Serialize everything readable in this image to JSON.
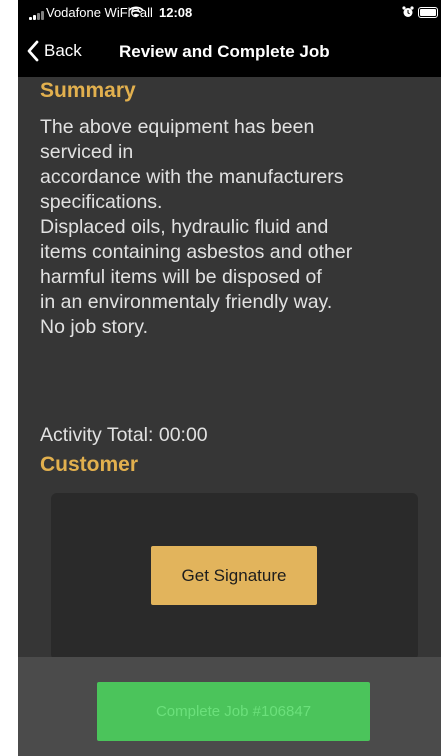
{
  "status_bar": {
    "carrier": "Vodafone WiFiCall",
    "time": "12:08",
    "icons": [
      "signal-icon",
      "wifi-icon",
      "alarm-icon",
      "battery-icon"
    ]
  },
  "nav": {
    "back_label": "Back",
    "title": "Review and Complete Job"
  },
  "summary": {
    "heading": "Summary",
    "lines": [
      "The above equipment has been",
      "serviced in",
      "accordance with the manufacturers",
      "specifications.",
      "Displaced oils, hydraulic fluid and",
      "items containing asbestos and other",
      "harmful items will be disposed of",
      "in an environmentaly friendly way.",
      "No job story."
    ]
  },
  "activity_total": "Activity Total: 00:00",
  "customer": {
    "heading": "Customer",
    "signature_button": "Get Signature"
  },
  "footer": {
    "complete_button": "Complete Job #106847",
    "complete_enabled": false
  },
  "colors": {
    "accent": "#e2b04e",
    "background": "#363636",
    "header": "#000000",
    "complete_button": "#4bc45b"
  }
}
